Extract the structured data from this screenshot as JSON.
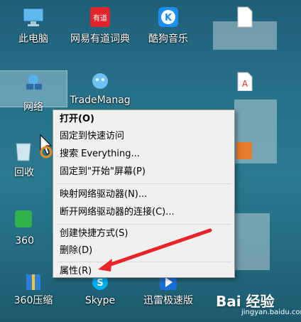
{
  "desktop_icons": {
    "this_pc": "此电脑",
    "youdao": "网易有道词典",
    "kugou": "酷狗音乐",
    "network": "网络",
    "trademanager": "TradeManag",
    "recycle": "回收",
    "icon_360": "360",
    "icon_360zip": "360压缩",
    "skype": "Skype",
    "xunlei": "迅雷极速版"
  },
  "context_menu": {
    "items": [
      "打开(O)",
      "固定到快速访问",
      "搜索 Everything...",
      "固定到\"开始\"屏幕(P)",
      "映射网络驱动器(N)...",
      "断开网络驱动器的连接(C)...",
      "创建快捷方式(S)",
      "删除(D)",
      "属性(R)"
    ]
  },
  "watermark": {
    "brand": "Bai 经验",
    "url": "jingyan.baidu.com"
  },
  "colors": {
    "desktop": "#27728a",
    "menu_bg": "#f0f0f0",
    "arrow": "#e8232a"
  }
}
